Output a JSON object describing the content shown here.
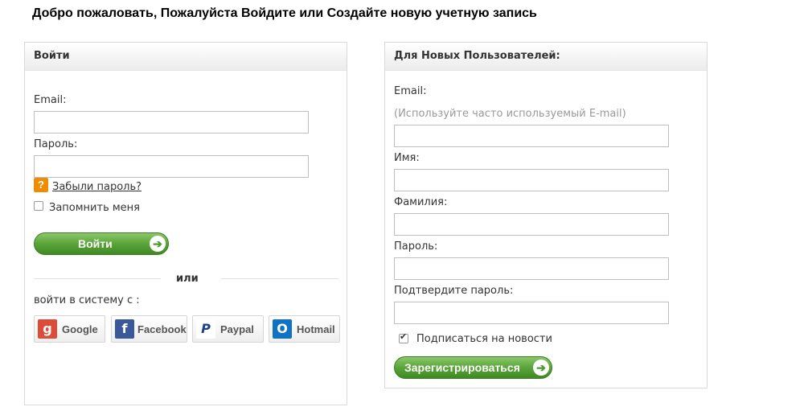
{
  "page": {
    "title": "Добро пожаловать, Пожалуйста Войдите или Создайте новую учетную запись"
  },
  "login": {
    "header": "Войти",
    "email_label": "Email:",
    "email_value": "",
    "password_label": "Пароль:",
    "password_value": "",
    "forgot_icon": "?",
    "forgot_link": "Забыли пароль?",
    "remember_label": "Запомнить меня",
    "remember_checked": false,
    "submit_label": "Войти",
    "or_text": "или",
    "social_prompt": "войти в систему с :",
    "social": [
      {
        "label": "Google",
        "icon": "google-icon",
        "glyph": "g",
        "color": "#dd4b39"
      },
      {
        "label": "Facebook",
        "icon": "facebook-icon",
        "glyph": "f",
        "color": "#3b5998"
      },
      {
        "label": "Paypal",
        "icon": "paypal-icon",
        "glyph": "P",
        "color": "#1b3f8b"
      },
      {
        "label": "Hotmail",
        "icon": "hotmail-icon",
        "glyph": "O",
        "color": "#1072c4"
      }
    ]
  },
  "register": {
    "header": "Для Новых Пользователей:",
    "email_label": "Email:",
    "email_hint": "(Используйте часто используемый E-mail)",
    "first_name_label": "Имя:",
    "last_name_label": "Фамилия:",
    "password_label": "Пароль:",
    "confirm_label": "Подтвердите пароль:",
    "subscribe_label": "Подписаться на новости",
    "subscribe_checked": true,
    "submit_label": "Зарегистрироваться"
  },
  "colors": {
    "accent_green": "#5aa43a",
    "help_orange": "#f08c00"
  }
}
